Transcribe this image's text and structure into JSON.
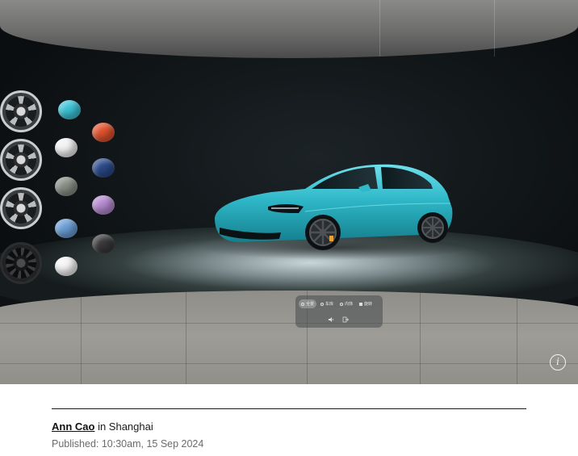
{
  "hero": {
    "view_tabs": [
      {
        "label": "全景",
        "active": true
      },
      {
        "label": "车库",
        "active": false
      },
      {
        "label": "内饰",
        "active": false
      },
      {
        "label": "旋转",
        "active": false
      }
    ],
    "car_color": "#2fb8c8",
    "swatches_left": [
      "#3cc3d6",
      "#f2f2f2",
      "#8a8f86",
      "#6b9fd6",
      "#f5f5f5"
    ],
    "swatches_right": [
      "#e0522e",
      "#2c4a8a",
      "#b58ad0",
      "#3a3a3c"
    ],
    "wheels": [
      "silver-aero",
      "silver-spoke",
      "silver-multi",
      "black-forged"
    ]
  },
  "caption": {
    "author": "Ann Cao",
    "location_text": " in Shanghai",
    "published": "Published: 10:30am, 15 Sep 2024"
  }
}
